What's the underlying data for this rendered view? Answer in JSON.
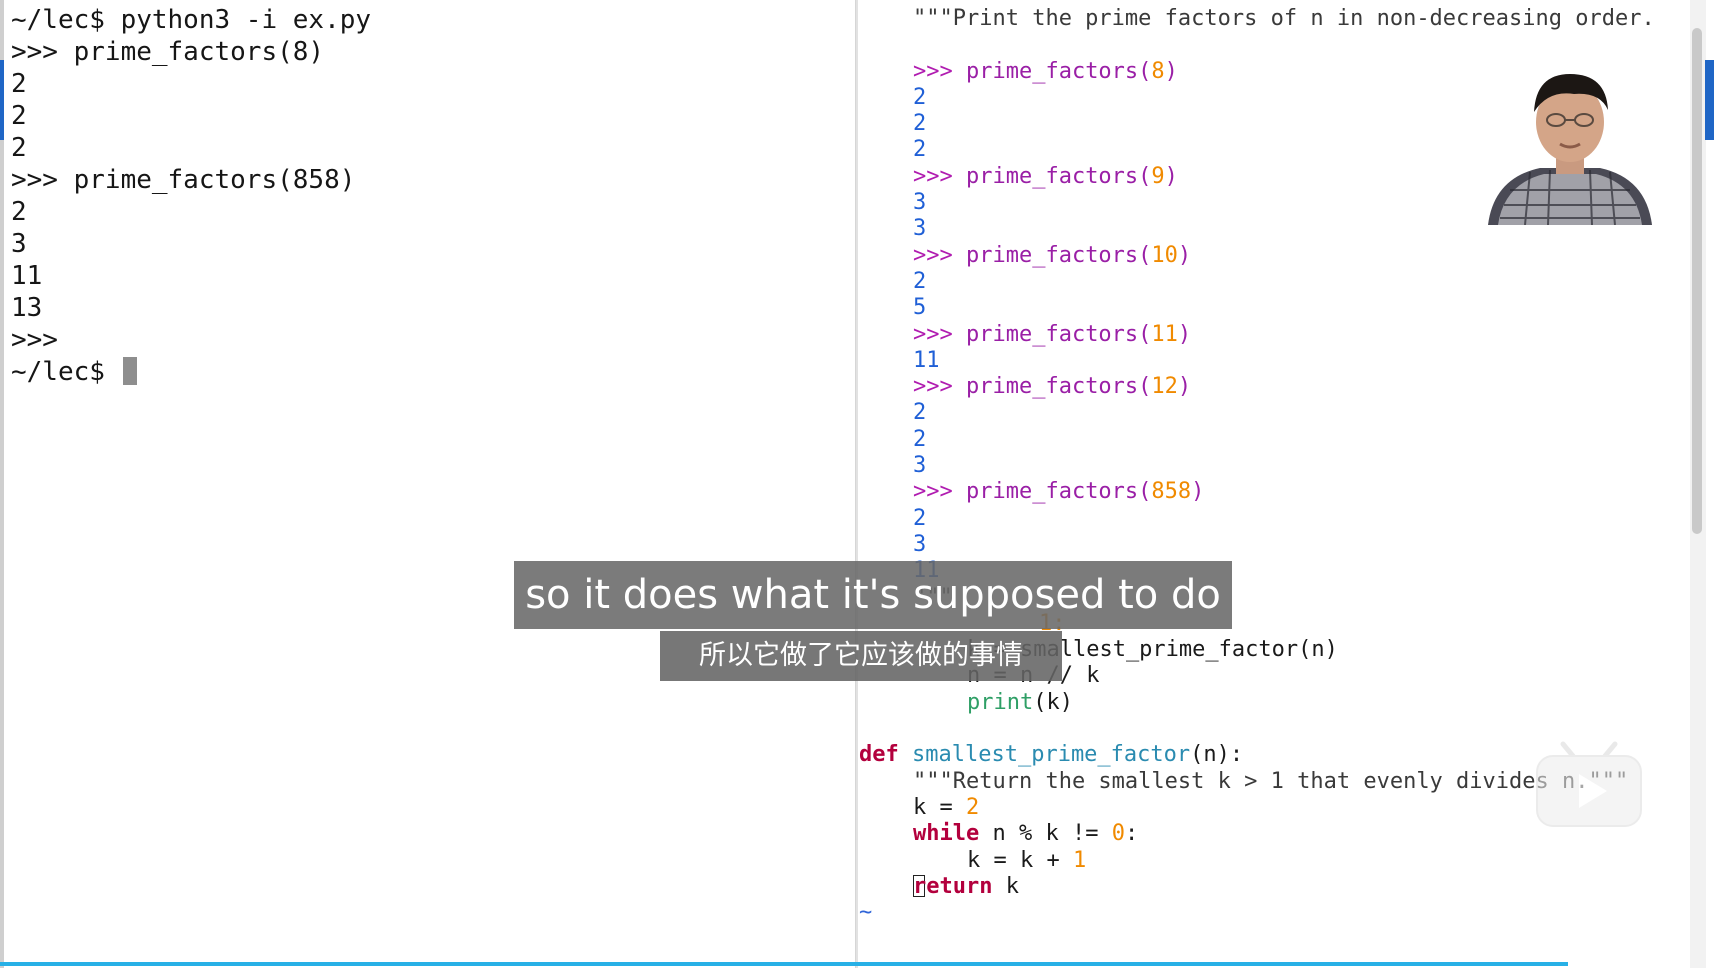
{
  "terminal": {
    "lines": [
      "~/lec$ python3 -i ex.py",
      ">>> prime_factors(8)",
      "2",
      "2",
      "2",
      ">>> prime_factors(858)",
      "2",
      "3",
      "11",
      "13",
      ">>>"
    ],
    "prompt_line": "~/lec$ "
  },
  "editor": {
    "docstring_line": "\"\"\"Print the prime factors of n in non-decreasing order.",
    "prompt": ">>>",
    "func_name": "prime_factors",
    "doctests": [
      {
        "arg": "8",
        "outputs": [
          "2",
          "2",
          "2"
        ]
      },
      {
        "arg": "9",
        "outputs": [
          "3",
          "3"
        ]
      },
      {
        "arg": "10",
        "outputs": [
          "2",
          "5"
        ]
      },
      {
        "arg": "11",
        "outputs": [
          "11"
        ]
      },
      {
        "arg": "12",
        "outputs": [
          "2",
          "2",
          "3"
        ]
      },
      {
        "arg": "858",
        "outputs": [
          "2",
          "3",
          "11"
        ]
      }
    ],
    "partial_docstring_close": "\"\"\"",
    "while_tail": "1:",
    "body_line1": "k = smallest_prime_factor(n)",
    "body_line2": "n = n // k",
    "body_print": "print",
    "body_print_arg": "(k)",
    "def_kw": "def",
    "def_name": "smallest_prime_factor",
    "def_sig": "(n):",
    "def_doc": "\"\"\"Return the smallest k > 1 that evenly divides n.\"\"\"",
    "init_var": "k = ",
    "init_val": "2",
    "while_kw": "while",
    "while_cond": " n % k != ",
    "while_zero": "0",
    "while_colon": ":",
    "incr": "k = k + ",
    "incr_val": "1",
    "return_kw": "return",
    "return_rest": " k",
    "tilde": "~"
  },
  "subtitles": {
    "english": "so it does what it's supposed to do",
    "chinese": "所以它做了它应该做的事情"
  },
  "colors": {
    "progress": "#27b0e6",
    "accent": "#1f66c6"
  }
}
